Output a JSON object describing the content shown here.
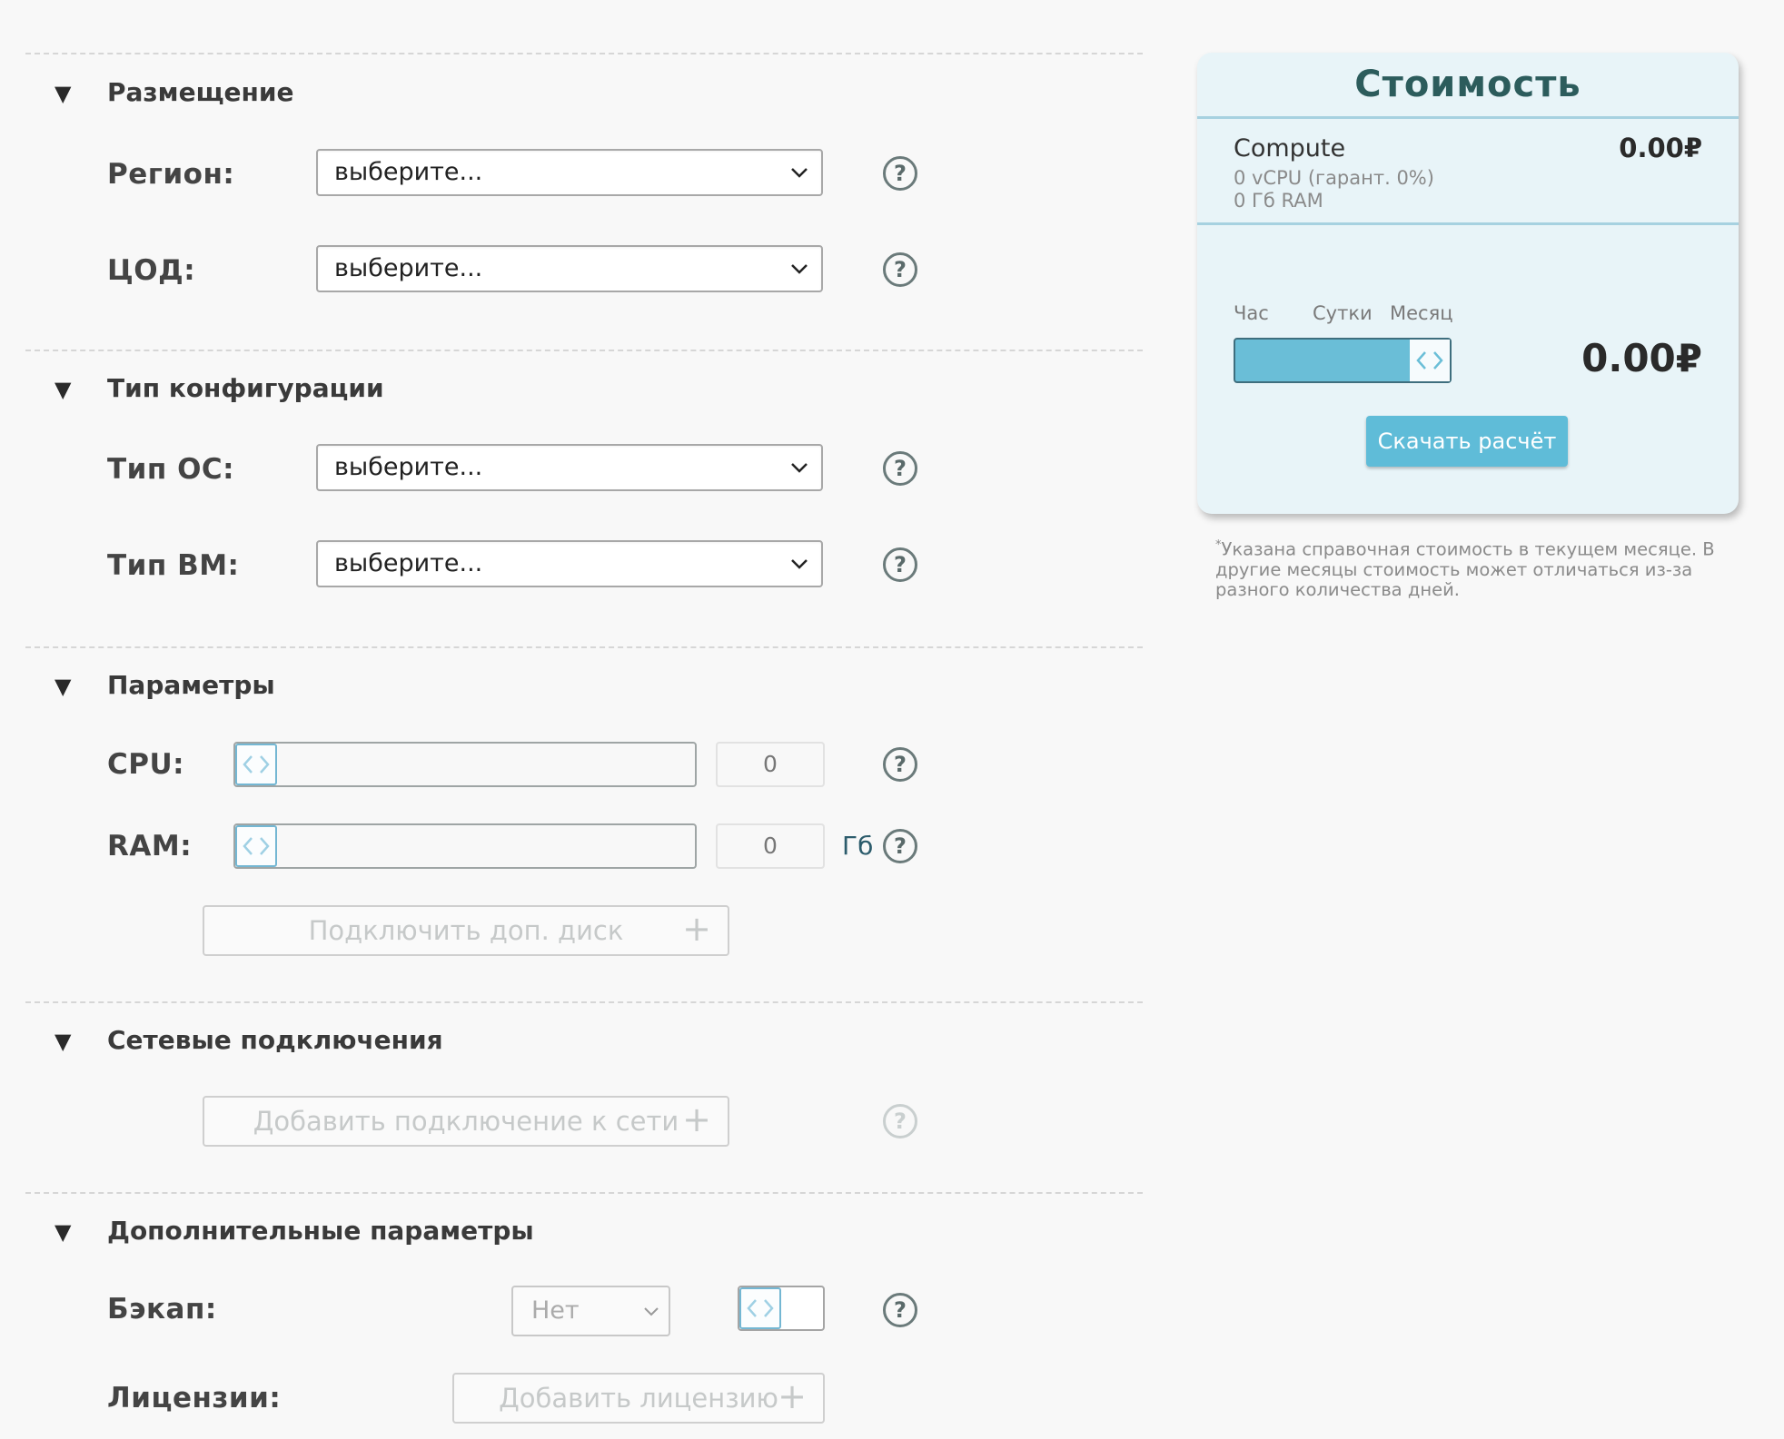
{
  "sections": {
    "placement": {
      "title": "Размещение",
      "region_label": "Регион:",
      "region_value": "выберите...",
      "dc_label": "ЦОД:",
      "dc_value": "выберите..."
    },
    "config": {
      "title": "Тип конфигурации",
      "os_label": "Тип ОС:",
      "os_value": "выберите...",
      "vm_label": "Тип ВМ:",
      "vm_value": "выберите..."
    },
    "params": {
      "title": "Параметры",
      "cpu_label": "CPU:",
      "cpu_value": "0",
      "ram_label": "RAM:",
      "ram_value": "0",
      "ram_unit": "Гб",
      "add_disk_label": "Подключить доп. диск"
    },
    "network": {
      "title": "Сетевые подключения",
      "add_network_label": "Добавить подключение к сети"
    },
    "extra": {
      "title": "Дополнительные параметры",
      "backup_label": "Бэкап:",
      "backup_value": "Нет",
      "license_label": "Лицензии:",
      "add_license_label": "Добавить лицензию"
    }
  },
  "help_glyph": "?",
  "triangle_glyph": "▼",
  "plus_glyph": "+",
  "cost": {
    "title": "Стоимость",
    "compute_name": "Compute",
    "compute_price": "0.00₽",
    "compute_cpu": "0 vCPU (гарант. 0%)",
    "compute_ram": "0 Гб RAM",
    "period_hour": "Час",
    "period_day": "Сутки",
    "period_month": "Месяц",
    "selected_period": "Месяц",
    "total_price": "0.00₽",
    "download_label": "Скачать расчёт",
    "note_mark": "*",
    "note_text": "Указана справочная стоимость в текущем месяце. В другие месяцы стоимость может отличаться из-за разного количества дней."
  },
  "colors": {
    "accent": "#5fbcd8",
    "card_bg": "#e8f4f8",
    "title": "#2c5c5c"
  }
}
